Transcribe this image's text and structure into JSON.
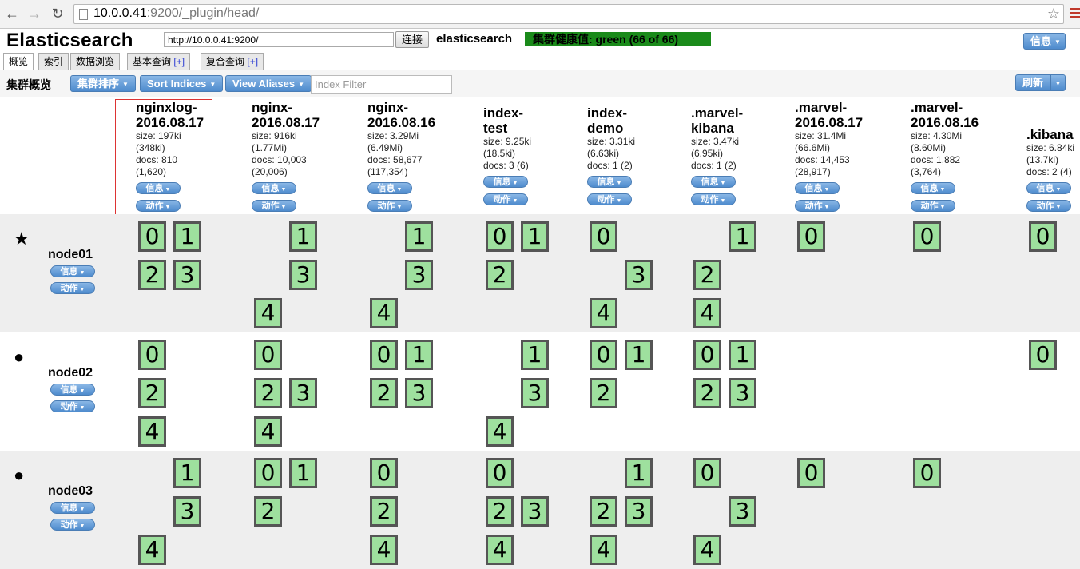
{
  "browser": {
    "url_host": "10.0.0.41",
    "url_rest": ":9200/_plugin/head/"
  },
  "header": {
    "title": "Elasticsearch",
    "connection_url": "http://10.0.0.41:9200/",
    "connect_label": "连接",
    "cluster_name": "elasticsearch",
    "health": "集群健康值: green (66 of 66)",
    "health_color": "#1a8a1a",
    "info_label": "信息"
  },
  "tabs": [
    {
      "label": "概览"
    },
    {
      "label": "索引"
    },
    {
      "label": "数据浏览"
    },
    {
      "label": "基本查询",
      "plus": "[+]"
    },
    {
      "label": "复合查询",
      "plus": "[+]"
    }
  ],
  "toolbar": {
    "title": "集群概览",
    "sort_cluster": "集群排序",
    "sort_indices": "Sort Indices",
    "view_aliases": "View Aliases",
    "filter_placeholder": "Index Filter",
    "refresh": "刷新"
  },
  "buttons": {
    "info": "信息",
    "action": "动作"
  },
  "indices": [
    {
      "name": "nginxlog-\n2016.08.17",
      "size": "size: 197ki",
      "size_total": "(348ki)",
      "docs": "docs: 810",
      "docs_total": "(1,620)"
    },
    {
      "name": "nginx-\n2016.08.17",
      "size": "size: 916ki",
      "size_total": "(1.77Mi)",
      "docs": "docs: 10,003",
      "docs_total": "(20,006)"
    },
    {
      "name": "nginx-\n2016.08.16",
      "size": "size: 3.29Mi",
      "size_total": "(6.49Mi)",
      "docs": "docs: 58,677",
      "docs_total": "(117,354)"
    },
    {
      "name": "index-\ntest",
      "size": "size: 9.25ki",
      "size_total": "(18.5ki)",
      "docs": "docs: 3 (6)",
      "docs_total": ""
    },
    {
      "name": "index-\ndemo",
      "size": "size: 3.31ki",
      "size_total": "(6.63ki)",
      "docs": "docs: 1 (2)",
      "docs_total": ""
    },
    {
      "name": ".marvel-\nkibana",
      "size": "size: 3.47ki",
      "size_total": "(6.95ki)",
      "docs": "docs: 1 (2)",
      "docs_total": ""
    },
    {
      "name": ".marvel-\n2016.08.17",
      "size": "size: 31.4Mi",
      "size_total": "(66.6Mi)",
      "docs": "docs: 14,453",
      "docs_total": "(28,917)"
    },
    {
      "name": ".marvel-\n2016.08.16",
      "size": "size: 4.30Mi",
      "size_total": "(8.60Mi)",
      "docs": "docs: 1,882",
      "docs_total": "(3,764)"
    },
    {
      "name": ".kibana",
      "size": "size: 6.84ki",
      "size_total": "(13.7ki)",
      "docs": "docs: 2 (4)",
      "docs_total": ""
    }
  ],
  "nodes": [
    {
      "name": "node01",
      "marker": "★",
      "master": true,
      "shards": [
        [
          [
            0,
            "0"
          ],
          [
            0,
            "1"
          ],
          [
            0,
            "2"
          ],
          [
            0,
            "3"
          ]
        ],
        [
          [
            1,
            "1"
          ],
          [
            1,
            "3"
          ],
          [
            1,
            "4"
          ]
        ],
        [
          [
            2,
            "1"
          ],
          [
            2,
            "3"
          ],
          [
            2,
            "4"
          ]
        ],
        [
          [
            3,
            "0"
          ],
          [
            3,
            "1"
          ],
          [
            3,
            "2"
          ]
        ],
        [
          [
            4,
            "0"
          ],
          [
            4,
            "3"
          ],
          [
            4,
            "4"
          ]
        ],
        [
          [
            5,
            "1"
          ],
          [
            5,
            "2"
          ],
          [
            5,
            "4"
          ]
        ],
        [
          [
            6,
            "0"
          ]
        ],
        [
          [
            7,
            "0"
          ]
        ],
        [
          [
            8,
            "0"
          ]
        ]
      ]
    },
    {
      "name": "node02",
      "marker": "●",
      "master": false,
      "shards": [
        [
          [
            0,
            "0"
          ],
          [
            0,
            "2"
          ],
          [
            0,
            "4"
          ]
        ],
        [
          [
            1,
            "0"
          ],
          [
            1,
            "2"
          ],
          [
            1,
            "3"
          ],
          [
            1,
            "4"
          ]
        ],
        [
          [
            2,
            "0"
          ],
          [
            2,
            "1"
          ],
          [
            2,
            "2"
          ],
          [
            2,
            "3"
          ]
        ],
        [
          [
            3,
            "1"
          ],
          [
            3,
            "3"
          ],
          [
            3,
            "4"
          ]
        ],
        [
          [
            4,
            "0"
          ],
          [
            4,
            "1"
          ],
          [
            4,
            "2"
          ]
        ],
        [
          [
            5,
            "0"
          ],
          [
            5,
            "1"
          ],
          [
            5,
            "2"
          ],
          [
            5,
            "3"
          ]
        ],
        [],
        [],
        [
          [
            8,
            "0"
          ]
        ]
      ]
    },
    {
      "name": "node03",
      "marker": "●",
      "master": false,
      "shards": [
        [
          [
            0,
            "1"
          ],
          [
            0,
            "3"
          ],
          [
            0,
            "4"
          ]
        ],
        [
          [
            1,
            "0"
          ],
          [
            1,
            "1"
          ],
          [
            1,
            "2"
          ]
        ],
        [
          [
            2,
            "0"
          ],
          [
            2,
            "2"
          ],
          [
            2,
            "4"
          ]
        ],
        [
          [
            3,
            "0"
          ],
          [
            3,
            "2"
          ],
          [
            3,
            "3"
          ],
          [
            3,
            "4"
          ]
        ],
        [
          [
            4,
            "1"
          ],
          [
            4,
            "2"
          ],
          [
            4,
            "3"
          ],
          [
            4,
            "4"
          ]
        ],
        [
          [
            5,
            "0"
          ],
          [
            5,
            "3"
          ],
          [
            5,
            "4"
          ]
        ],
        [
          [
            6,
            "0"
          ]
        ],
        [
          [
            7,
            "0"
          ]
        ],
        []
      ]
    }
  ]
}
